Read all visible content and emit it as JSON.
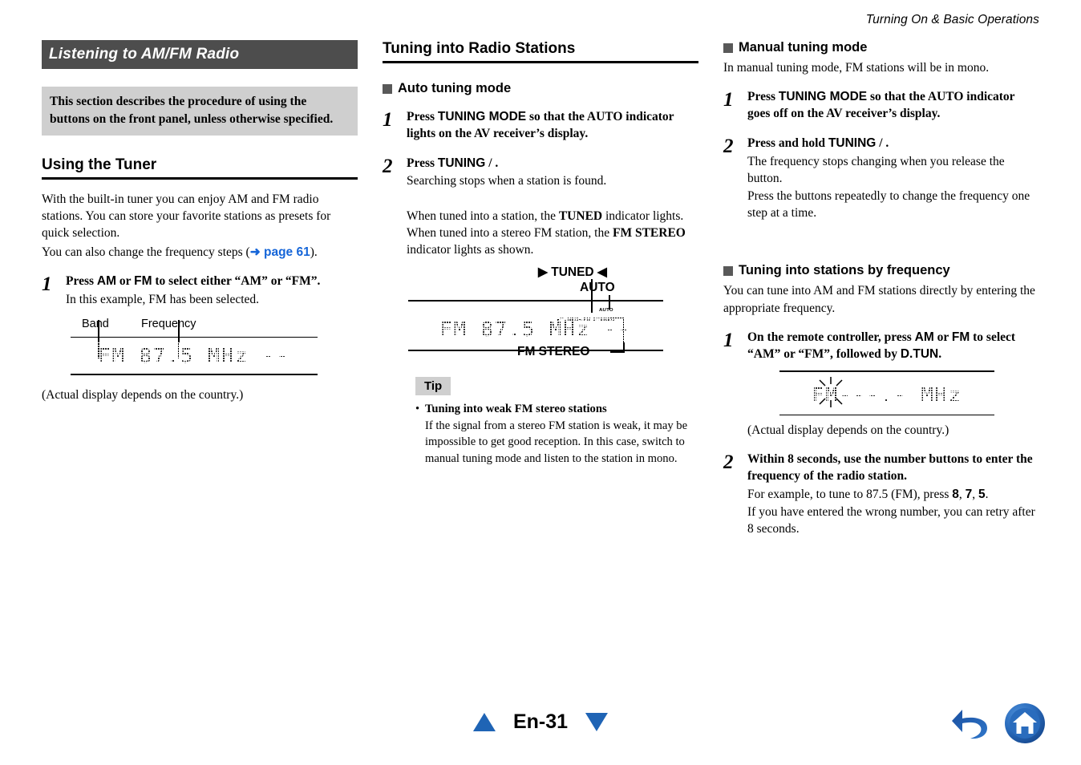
{
  "header": {
    "running_title": "Turning On & Basic Operations"
  },
  "column1": {
    "section_bar": "Listening to AM/FM Radio",
    "notice": "This section describes the procedure of using the buttons on the front panel, unless otherwise specified.",
    "heading": "Using the Tuner",
    "intro_1": "With the built-in tuner you can enjoy AM and FM radio stations. You can store your favorite stations as presets for quick selection.",
    "intro_2_pre": "You can also change the frequency steps (",
    "intro_2_link": "page 61",
    "intro_2_post": ").",
    "step1": {
      "num": "1",
      "title_pre": "Press ",
      "title_am": "AM",
      "title_mid": " or ",
      "title_fm": "FM",
      "title_post": " to select either “AM” or “FM”.",
      "text": "In this example, FM has been selected."
    },
    "figure": {
      "callout_band": "Band",
      "callout_frequency": "Frequency",
      "lcd_text": "FM 87.5 MHz --",
      "caption": "(Actual display depends on the country.)"
    }
  },
  "column2": {
    "heading": "Tuning into Radio Stations",
    "sub_heading": "Auto tuning mode",
    "step1": {
      "num": "1",
      "title_pre": "Press ",
      "title_bold": "TUNING MODE",
      "title_post": " so that the AUTO indicator lights on the AV receiver’s display."
    },
    "step2": {
      "num": "2",
      "title_pre": "Press ",
      "title_bold": "TUNING",
      "title_post": "   /  .",
      "text": "Searching stops when a station is found.",
      "para_a": "When tuned into a station, the ",
      "para_b": "TUNED",
      "para_c": " indicator lights. When tuned into a stereo FM station, the ",
      "para_d": "FM STEREO",
      "para_e": " indicator lights as shown."
    },
    "figure": {
      "label_tuned": "▶ TUNED ◀",
      "label_auto": "AUTO",
      "label_fm_stereo": "FM STEREO",
      "tiny_auto": "AUTO",
      "tiny_tuned": "▸TUNED◂ FM STEREO",
      "lcd_text": "FM 87.5 MHz --"
    },
    "tip": {
      "label": "Tip",
      "bullet_title": "Tuning into weak FM stereo stations",
      "bullet_text": "If the signal from a stereo FM station is weak, it may be impossible to get good reception. In this case, switch to manual tuning mode and listen to the station in mono."
    }
  },
  "column3": {
    "sub_heading_1": "Manual tuning mode",
    "intro_1": "In manual tuning mode, FM stations will be in mono.",
    "step1": {
      "num": "1",
      "title_pre": "Press ",
      "title_bold": "TUNING MODE",
      "title_post": " so that the AUTO indicator goes off on the AV receiver’s display."
    },
    "step2": {
      "num": "2",
      "title_pre": "Press and hold ",
      "title_bold": "TUNING",
      "title_post": "   /  .",
      "text_1": "The frequency stops changing when you release the button.",
      "text_2": "Press the buttons repeatedly to change the frequency one step at a time."
    },
    "sub_heading_2": "Tuning into stations by frequency",
    "intro_2": "You can tune into AM and FM stations directly by entering the appropriate frequency.",
    "step3": {
      "num": "1",
      "title_pre": "On the remote controller, press ",
      "title_am": "AM",
      "title_mid": " or ",
      "title_fm": "FM",
      "title_mid2": " to select “AM” or “FM”, followed by ",
      "title_dtun": "D.TUN",
      "title_post": "."
    },
    "figure": {
      "lcd_text": "FM---.- MHz",
      "caption": "(Actual display depends on the country.)"
    },
    "step4": {
      "num": "2",
      "title": "Within 8 seconds, use the number buttons to enter the frequency of the radio station.",
      "text_1_pre": "For example, to tune to 87.5 (FM), press ",
      "text_1_k1": "8",
      "text_1_k2": "7",
      "text_1_k3": "5",
      "text_1_post": ".",
      "text_2": "If you have entered the wrong number, you can retry after 8 seconds."
    }
  },
  "footer": {
    "page_label": "En-31",
    "prev_icon": "triangle-up-icon",
    "next_icon": "triangle-down-icon",
    "back_icon": "back-arrow-icon",
    "home_icon": "home-icon"
  },
  "colors": {
    "section_bar": "#4d4d4d",
    "notice_bg": "#cfcfcf",
    "link": "#1565D8",
    "nav_blue": "#1F64B5"
  }
}
